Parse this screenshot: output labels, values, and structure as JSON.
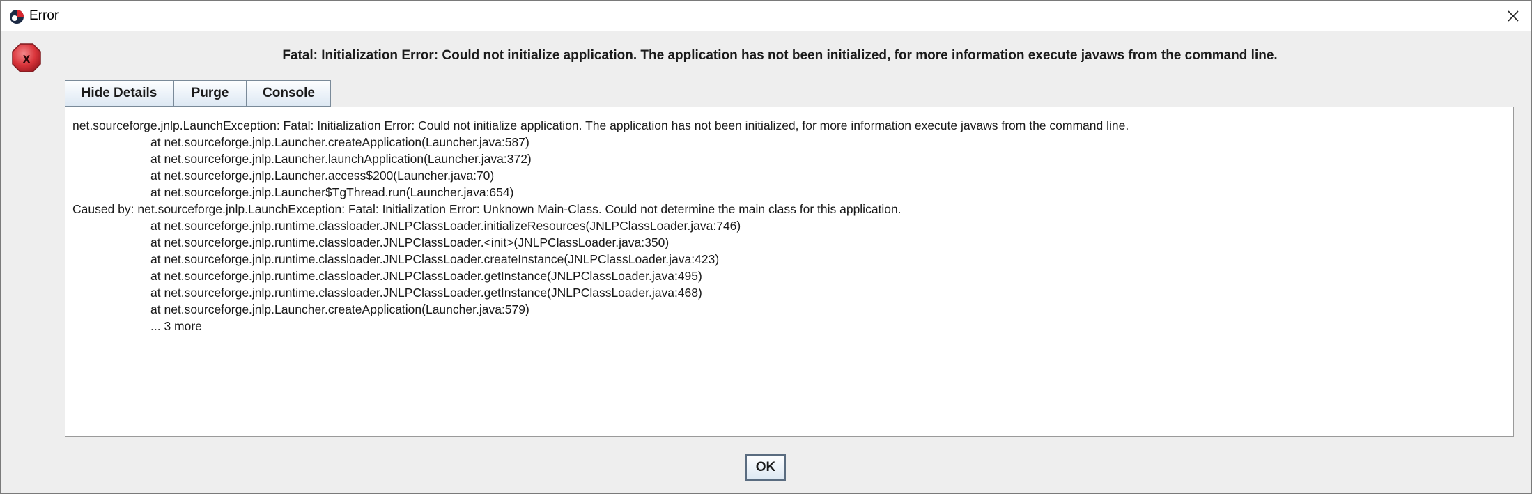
{
  "window": {
    "title": "Error"
  },
  "dialog": {
    "message": "Fatal: Initialization Error: Could not initialize application. The application has not been initialized, for more information execute javaws from the command line.",
    "tabs": {
      "hide_details": "Hide Details",
      "purge": "Purge",
      "console": "Console"
    },
    "trace": [
      {
        "text": "net.sourceforge.jnlp.LaunchException: Fatal: Initialization Error: Could not initialize application. The application has not been initialized, for more information execute javaws from the command line.",
        "indent": false
      },
      {
        "text": "at net.sourceforge.jnlp.Launcher.createApplication(Launcher.java:587)",
        "indent": true
      },
      {
        "text": "at net.sourceforge.jnlp.Launcher.launchApplication(Launcher.java:372)",
        "indent": true
      },
      {
        "text": "at net.sourceforge.jnlp.Launcher.access$200(Launcher.java:70)",
        "indent": true
      },
      {
        "text": "at net.sourceforge.jnlp.Launcher$TgThread.run(Launcher.java:654)",
        "indent": true
      },
      {
        "text": "Caused by: net.sourceforge.jnlp.LaunchException: Fatal: Initialization Error: Unknown Main-Class. Could not determine the main class for this application.",
        "indent": false
      },
      {
        "text": "at net.sourceforge.jnlp.runtime.classloader.JNLPClassLoader.initializeResources(JNLPClassLoader.java:746)",
        "indent": true
      },
      {
        "text": "at net.sourceforge.jnlp.runtime.classloader.JNLPClassLoader.<init>(JNLPClassLoader.java:350)",
        "indent": true
      },
      {
        "text": "at net.sourceforge.jnlp.runtime.classloader.JNLPClassLoader.createInstance(JNLPClassLoader.java:423)",
        "indent": true
      },
      {
        "text": "at net.sourceforge.jnlp.runtime.classloader.JNLPClassLoader.getInstance(JNLPClassLoader.java:495)",
        "indent": true
      },
      {
        "text": "at net.sourceforge.jnlp.runtime.classloader.JNLPClassLoader.getInstance(JNLPClassLoader.java:468)",
        "indent": true
      },
      {
        "text": "at net.sourceforge.jnlp.Launcher.createApplication(Launcher.java:579)",
        "indent": true
      },
      {
        "text": "... 3 more",
        "indent": true
      }
    ],
    "ok_label": "OK"
  },
  "icons": {
    "app": "java-app-icon",
    "error": "error-icon",
    "close": "close-icon"
  },
  "colors": {
    "error_red": "#d9343a",
    "window_bg": "#eeeeee"
  }
}
